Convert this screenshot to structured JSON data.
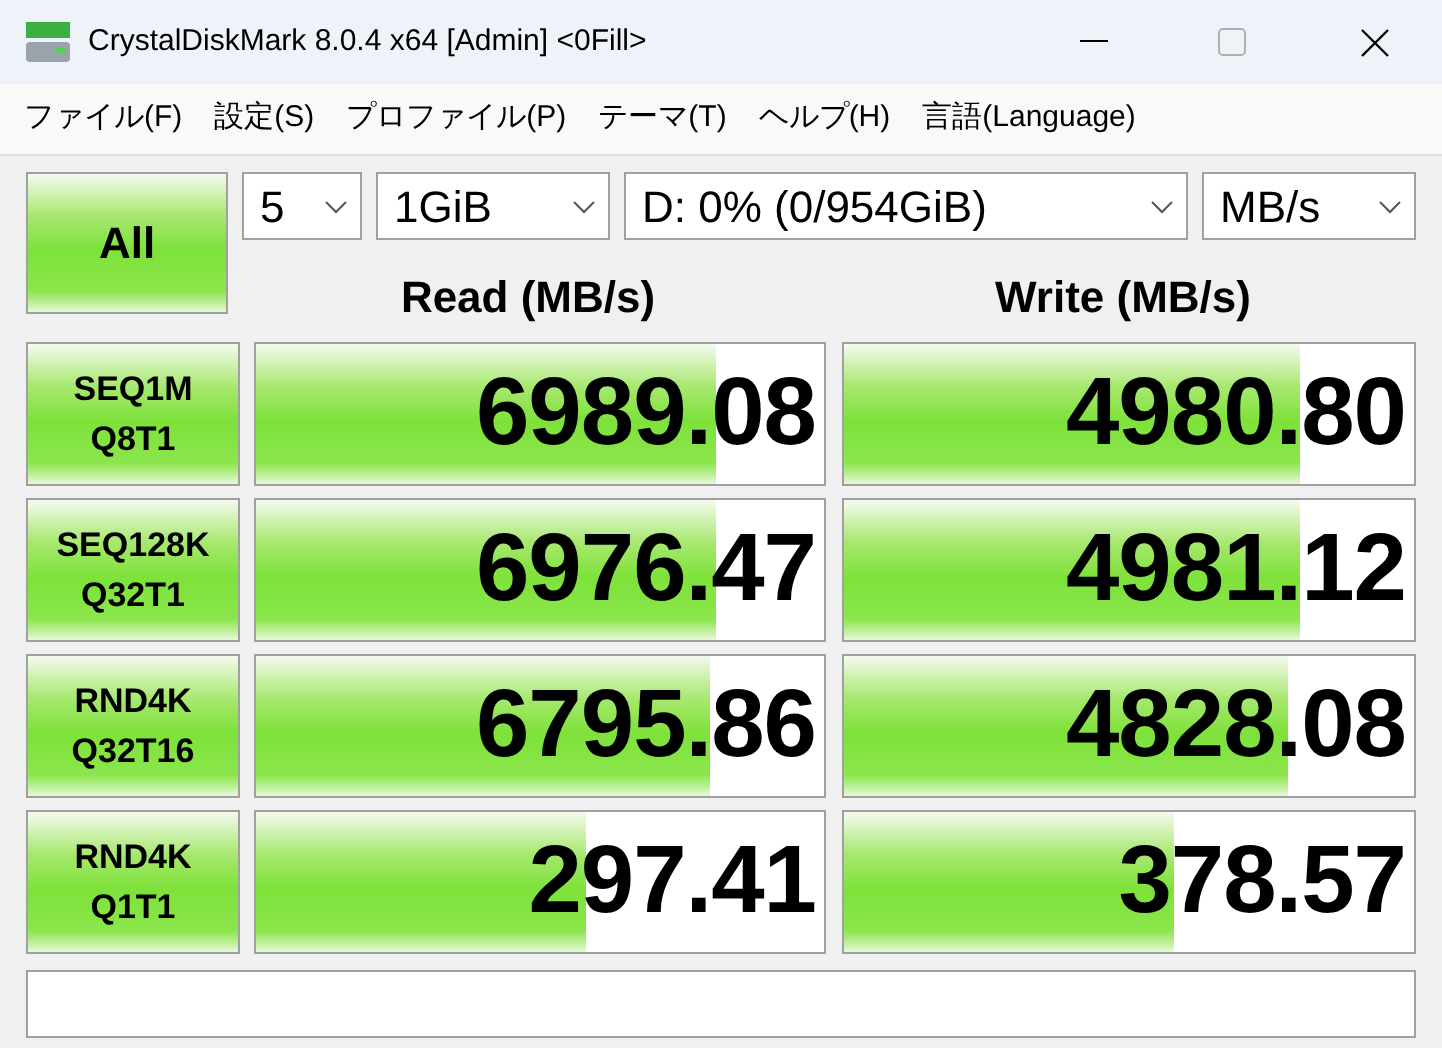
{
  "window": {
    "title": "CrystalDiskMark 8.0.4 x64 [Admin] <0Fill>"
  },
  "menu": [
    "ファイル(F)",
    "設定(S)",
    "プロファイル(P)",
    "テーマ(T)",
    "ヘルプ(H)",
    "言語(Language)"
  ],
  "all_button": "All",
  "selects": [
    {
      "value": "5"
    },
    {
      "value": "1GiB"
    },
    {
      "value": "D: 0% (0/954GiB)"
    },
    {
      "value": "MB/s"
    }
  ],
  "columns": [
    "Read (MB/s)",
    "Write (MB/s)"
  ],
  "rows": [
    {
      "test": [
        "SEQ1M",
        "Q8T1"
      ],
      "read": {
        "value": "6989.08",
        "level": 0.81
      },
      "write": {
        "value": "4980.80",
        "level": 0.8
      }
    },
    {
      "test": [
        "SEQ128K",
        "Q32T1"
      ],
      "read": {
        "value": "6976.47",
        "level": 0.81
      },
      "write": {
        "value": "4981.12",
        "level": 0.8
      }
    },
    {
      "test": [
        "RND4K",
        "Q32T16"
      ],
      "read": {
        "value": "6795.86",
        "level": 0.8
      },
      "write": {
        "value": "4828.08",
        "level": 0.78
      }
    },
    {
      "test": [
        "RND4K",
        "Q1T1"
      ],
      "read": {
        "value": "297.41",
        "level": 0.58
      },
      "write": {
        "value": "378.57",
        "level": 0.58
      }
    }
  ]
}
